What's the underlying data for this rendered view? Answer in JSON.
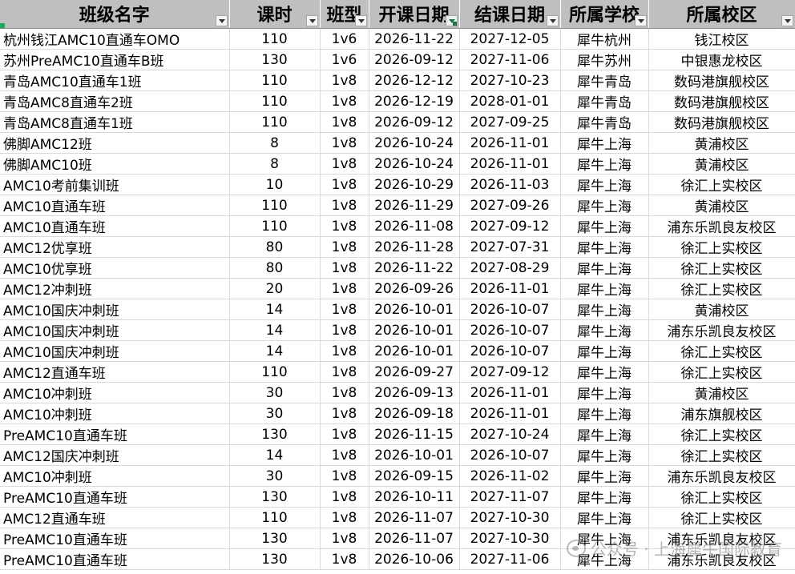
{
  "headers": [
    "班级名字",
    "课时",
    "班型",
    "开课日期",
    "结课日期",
    "所属学校",
    "所属校区"
  ],
  "rows": [
    [
      "杭州钱江AMC10直通车OMO",
      "110",
      "1v6",
      "2026-11-22",
      "2027-12-05",
      "犀牛杭州",
      "钱江校区"
    ],
    [
      "苏州PreAMC10直通车B班",
      "130",
      "1v6",
      "2026-09-12",
      "2027-11-06",
      "犀牛苏州",
      "中银惠龙校区"
    ],
    [
      "青岛AMC10直通车1班",
      "110",
      "1v8",
      "2026-12-12",
      "2027-10-23",
      "犀牛青岛",
      "数码港旗舰校区"
    ],
    [
      "青岛AMC8直通车2班",
      "110",
      "1v8",
      "2026-12-19",
      "2028-01-01",
      "犀牛青岛",
      "数码港旗舰校区"
    ],
    [
      "青岛AMC8直通车1班",
      "110",
      "1v8",
      "2026-09-12",
      "2027-09-25",
      "犀牛青岛",
      "数码港旗舰校区"
    ],
    [
      "佛脚AMC12班",
      "8",
      "1v8",
      "2026-10-24",
      "2026-11-01",
      "犀牛上海",
      "黄浦校区"
    ],
    [
      "佛脚AMC10班",
      "8",
      "1v8",
      "2026-10-24",
      "2026-11-01",
      "犀牛上海",
      "黄浦校区"
    ],
    [
      "AMC10考前集训班",
      "10",
      "1v8",
      "2026-10-29",
      "2026-11-03",
      "犀牛上海",
      "徐汇上实校区"
    ],
    [
      "AMC10直通车班",
      "110",
      "1v8",
      "2026-11-29",
      "2027-09-26",
      "犀牛上海",
      "黄浦校区"
    ],
    [
      "AMC10直通车班",
      "110",
      "1v8",
      "2026-11-08",
      "2027-09-12",
      "犀牛上海",
      "浦东乐凯良友校区"
    ],
    [
      "AMC12优享班",
      "80",
      "1v8",
      "2026-11-28",
      "2027-07-31",
      "犀牛上海",
      "徐汇上实校区"
    ],
    [
      "AMC10优享班",
      "80",
      "1v8",
      "2026-11-22",
      "2027-08-29",
      "犀牛上海",
      "徐汇上实校区"
    ],
    [
      "AMC12冲刺班",
      "20",
      "1v8",
      "2026-09-26",
      "2026-11-01",
      "犀牛上海",
      "徐汇上实校区"
    ],
    [
      "AMC10国庆冲刺班",
      "14",
      "1v8",
      "2026-10-01",
      "2026-10-07",
      "犀牛上海",
      "黄浦校区"
    ],
    [
      "AMC10国庆冲刺班",
      "14",
      "1v8",
      "2026-10-01",
      "2026-10-07",
      "犀牛上海",
      "浦东乐凯良友校区"
    ],
    [
      "AMC10国庆冲刺班",
      "14",
      "1v8",
      "2026-10-01",
      "2026-10-07",
      "犀牛上海",
      "徐汇上实校区"
    ],
    [
      "AMC12直通车班",
      "110",
      "1v8",
      "2026-09-27",
      "2027-09-12",
      "犀牛上海",
      "徐汇上实校区"
    ],
    [
      "AMC10冲刺班",
      "30",
      "1v8",
      "2026-09-13",
      "2026-11-01",
      "犀牛上海",
      "黄浦校区"
    ],
    [
      "AMC10冲刺班",
      "30",
      "1v8",
      "2026-09-18",
      "2026-11-01",
      "犀牛上海",
      "浦东旗舰校区"
    ],
    [
      "PreAMC10直通车班",
      "130",
      "1v8",
      "2026-11-15",
      "2027-10-24",
      "犀牛上海",
      "徐汇上实校区"
    ],
    [
      "AMC12国庆冲刺班",
      "14",
      "1v8",
      "2026-10-01",
      "2026-10-07",
      "犀牛上海",
      "徐汇上实校区"
    ],
    [
      "AMC10冲刺班",
      "30",
      "1v8",
      "2026-09-15",
      "2026-11-02",
      "犀牛上海",
      "浦东乐凯良友校区"
    ],
    [
      "PreAMC10直通车班",
      "130",
      "1v8",
      "2026-10-11",
      "2027-11-07",
      "犀牛上海",
      "徐汇上实校区"
    ],
    [
      "AMC12直通车班",
      "110",
      "1v8",
      "2026-11-07",
      "2027-10-30",
      "犀牛上海",
      "徐汇上实校区"
    ],
    [
      "PreAMC10直通车班",
      "130",
      "1v8",
      "2026-11-07",
      "2027-10-30",
      "犀牛上海",
      "浦东乐凯良友校区"
    ],
    [
      "PreAMC10直通车班",
      "130",
      "1v8",
      "2026-10-06",
      "2027-11-06",
      "犀牛上海",
      "浦东乐凯良友校区"
    ]
  ],
  "filter_active_column": 3,
  "watermark": "公众号 · 上海犀牛国际教育"
}
